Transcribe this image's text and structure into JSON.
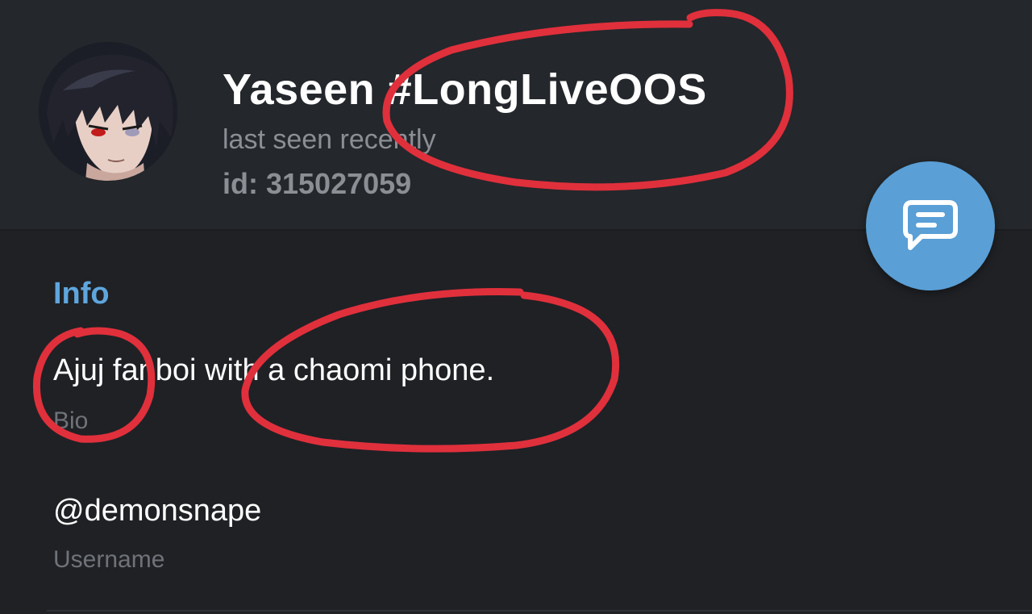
{
  "profile": {
    "name": "Yaseen #LongLiveOOS",
    "status": "last seen recently",
    "id_text": "id: 315027059"
  },
  "info": {
    "section_title": "Info",
    "bio": {
      "value": "Ajuj fanboi with a chaomi phone.",
      "label": "Bio"
    },
    "username": {
      "value": "@demonsnape",
      "label": "Username"
    }
  },
  "fab": {
    "icon": "message-icon"
  },
  "colors": {
    "accent": "#5a9fd6",
    "section_title": "#5fa6dd",
    "background": "#1f2125",
    "header_background": "#24272b",
    "annotation_red": "#e0303c"
  }
}
